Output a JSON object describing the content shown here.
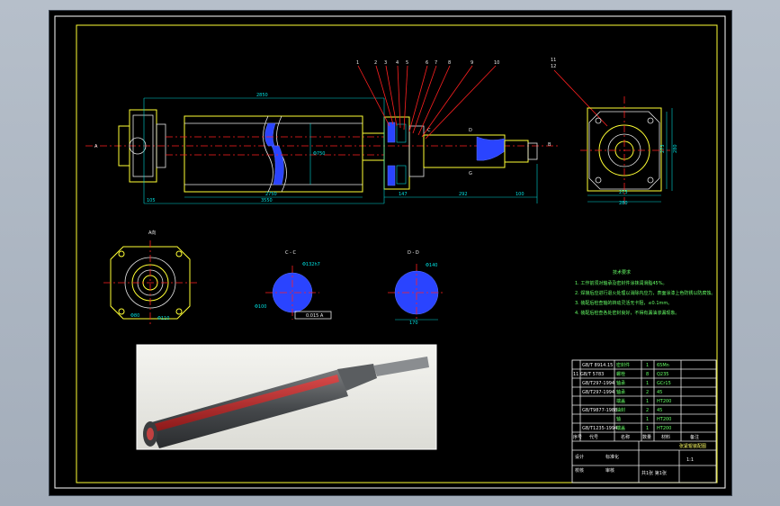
{
  "drawing": {
    "main_labels": {
      "left_end": "A",
      "right_end": "B",
      "overall_length": "2850",
      "body_length": "2750",
      "total_span": "3550",
      "left_offset": "105",
      "seg_147": "147",
      "seg_292": "292",
      "seg_100": "100",
      "diameter_body": "Φ750",
      "section_c_tag": "C",
      "section_d_tag": "D",
      "section_g_tag": "G"
    },
    "balloons": [
      "1",
      "2",
      "3",
      "4",
      "5",
      "6",
      "7",
      "8",
      "9",
      "10",
      "11",
      "12"
    ],
    "side_view": {
      "dim_273": "273",
      "dim_280": "280",
      "dim_v1": "273",
      "dim_v2": "280"
    },
    "view_a": {
      "title": "A向",
      "dim1": "Φ80",
      "dim2": "Φ110"
    },
    "section_cc": {
      "title": "C - C",
      "dim1": "Φ132h7",
      "dim2": "Φ100",
      "tol": "0.015 A"
    },
    "section_dd": {
      "title": "D - D",
      "dim1": "Φ140",
      "dim2": "170"
    },
    "notes": {
      "title": "技术要求",
      "items": [
        "1. 工作前须对轴承及密封件涂抹润滑脂45%。",
        "2. 焊接后应进行退火处理以消除内应力，表面涂漆上色防锈以防腐蚀。",
        "3. 装配后检查轴的转动灵活无卡阻，≤0.1mm。",
        "4. 装配后检查各处密封良好，不得有漏油渗漏现象。"
      ]
    }
  },
  "title_block": {
    "rows": [
      {
        "code": "GB/T 8914.15",
        "name": "密封件",
        "qty": "1",
        "mat": "65Mn"
      },
      {
        "code": "11 GB/T 5783",
        "name": "螺栓",
        "qty": "8",
        "mat": "Q235"
      },
      {
        "code": "GB/T297-1994",
        "name": "轴承",
        "qty": "1",
        "mat": "GCr15"
      },
      {
        "code": "GB/T297-1994",
        "name": "轴承",
        "qty": "2",
        "mat": "45"
      },
      {
        "code": "",
        "name": "端盖",
        "qty": "1",
        "mat": "HT200"
      },
      {
        "code": "GB/T9877-1988",
        "name": "油封",
        "qty": "2",
        "mat": "45"
      },
      {
        "code": "",
        "name": "轴",
        "qty": "1",
        "mat": "HT200"
      },
      {
        "code": "GB/T1235-1994",
        "name": "端盖",
        "qty": "1",
        "mat": "HT200"
      }
    ],
    "headers": {
      "num": "序号",
      "code": "代号",
      "name": "名称",
      "qty": "数量",
      "mat": "材料",
      "note": "备注"
    },
    "drawing_title": "张紧辊装配图",
    "scale": "1:1",
    "labels": {
      "design": "设计",
      "check": "校核",
      "approve": "审核",
      "standard": "标准化",
      "sheet": "共1张 第1张"
    }
  }
}
